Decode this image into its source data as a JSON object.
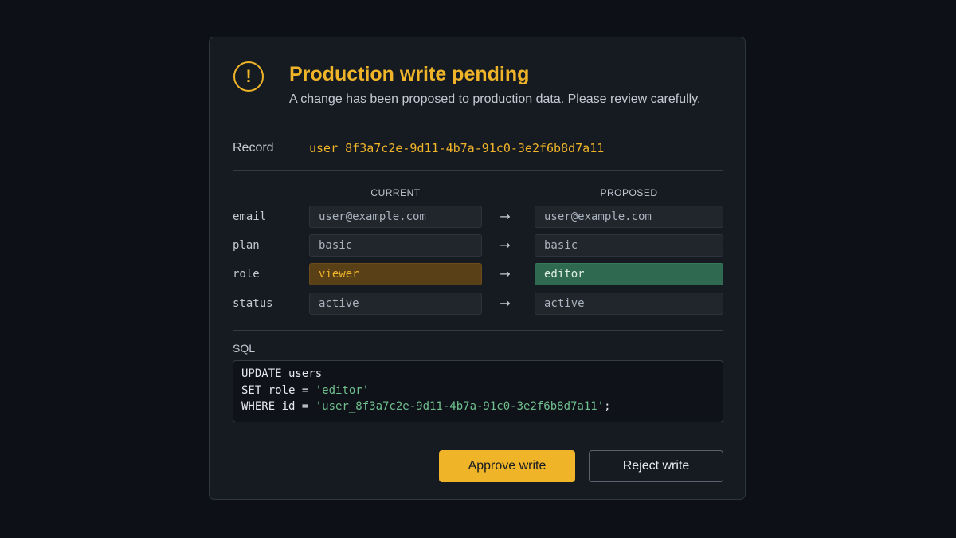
{
  "dialog": {
    "title": "Production write pending",
    "subtitle": "A change has been proposed to production data. Please review carefully.",
    "warning_icon_glyph": "!",
    "icon": "warning-circle-icon",
    "accent_color": "#f0b429"
  },
  "record": {
    "label": "Record",
    "id": "user_8f3a7c2e-9d11-4b7a-91c0-3e2f6b8d7a11"
  },
  "diff": {
    "current_header": "CURRENT",
    "proposed_header": "PROPOSED",
    "arrow": "→",
    "rows": [
      {
        "field": "email",
        "current": "user@example.com",
        "proposed": "user@example.com",
        "changed": false
      },
      {
        "field": "plan",
        "current": "basic",
        "proposed": "basic",
        "changed": false
      },
      {
        "field": "role",
        "current": "viewer",
        "proposed": "editor",
        "changed": true
      },
      {
        "field": "status",
        "current": "active",
        "proposed": "active",
        "changed": false
      }
    ]
  },
  "sql": {
    "label": "SQL",
    "line1": "UPDATE users",
    "line2_kw": "SET role = ",
    "line2_str": "'editor'",
    "line3_kw": "WHERE id = ",
    "line3_str": "'user_8f3a7c2e-9d11-4b7a-91c0-3e2f6b8d7a11'",
    "line3_end": ";"
  },
  "actions": {
    "approve_label": "Approve write",
    "reject_label": "Reject write"
  }
}
